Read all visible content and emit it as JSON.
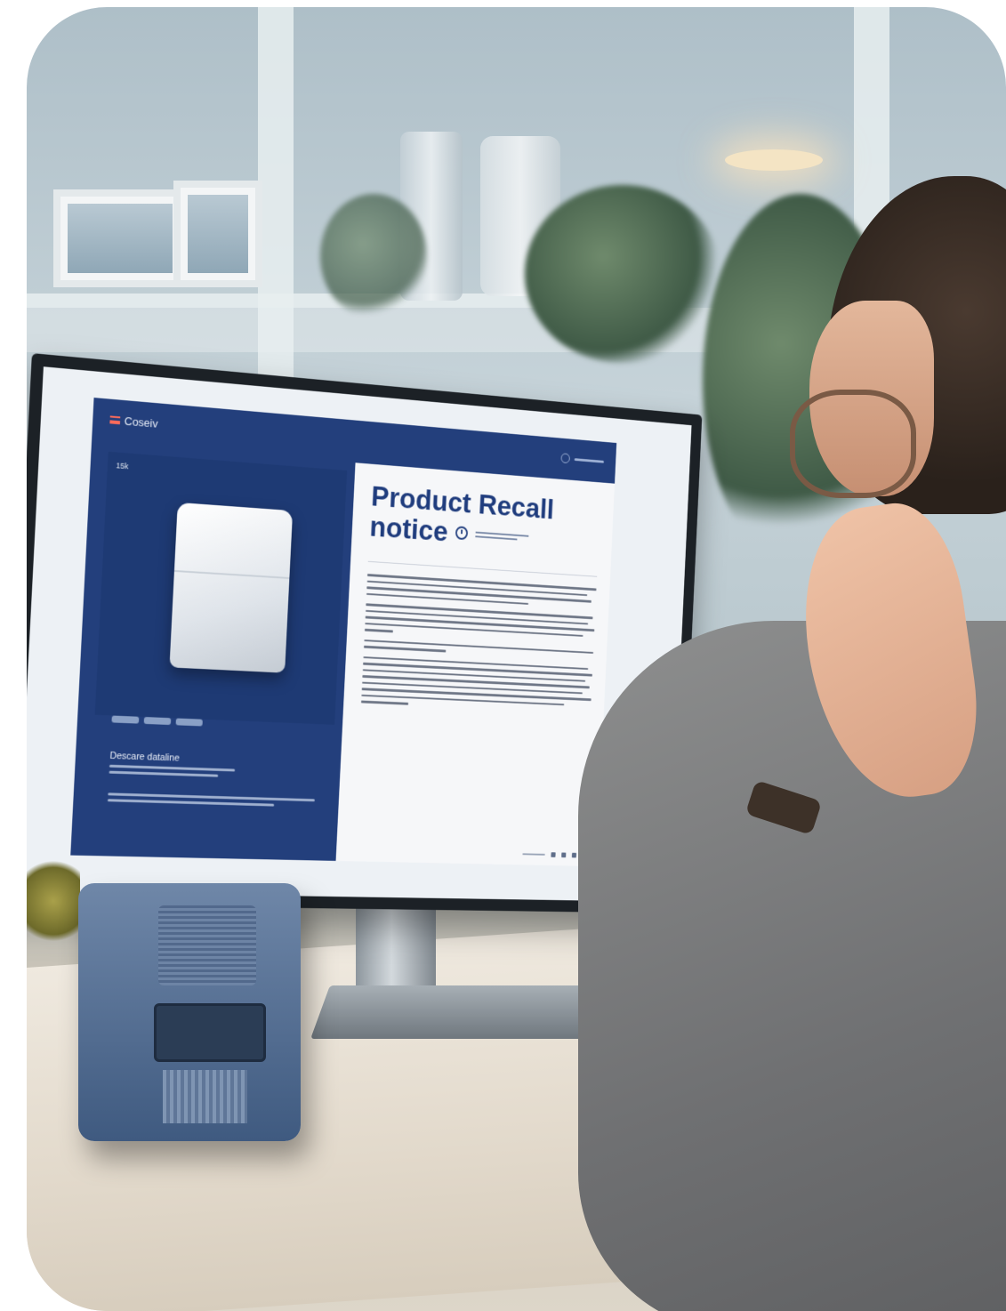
{
  "photo": {
    "description_colors": {
      "screen_accent": "#233f7c",
      "title_color": "#1f3c7d",
      "alert_accent": "#ff6b5a"
    }
  },
  "app": {
    "brand_name": "Coseiv",
    "product_image_tag": "15k",
    "title_line1": "Product Recall",
    "title_line2": "notice",
    "caption_title": "Descare dataline",
    "body_paragraph_count": 5
  },
  "icons": {
    "menu": "menu-icon",
    "clock": "clock-icon",
    "user": "user-icon"
  }
}
